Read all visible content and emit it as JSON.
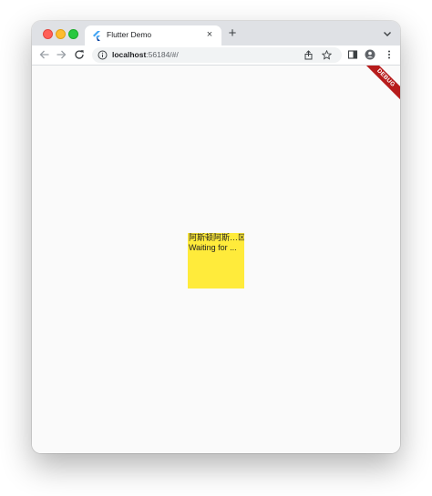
{
  "browser": {
    "tab": {
      "title": "Flutter Demo",
      "close_glyph": "×",
      "favicon": "flutter-logo-icon"
    },
    "new_tab_glyph": "+",
    "address": {
      "host": "localhost",
      "path": ":56184/#/"
    },
    "icons": {
      "back": "arrow-left-icon",
      "forward": "arrow-right-icon",
      "reload": "reload-icon",
      "info": "info-icon",
      "share": "share-icon",
      "bookmark": "star-icon",
      "side_panel": "side-panel-icon",
      "profile": "profile-icon",
      "menu": "kebab-menu-icon",
      "tab_search": "chevron-down-icon"
    }
  },
  "app": {
    "debug_banner": "DEBUG",
    "box_lines": [
      "阿斯顿阿斯…⊠",
      "Waiting for ..."
    ],
    "colors": {
      "box": "#ffeb3b",
      "banner": "#b71c1c",
      "background": "#fafafa"
    }
  }
}
